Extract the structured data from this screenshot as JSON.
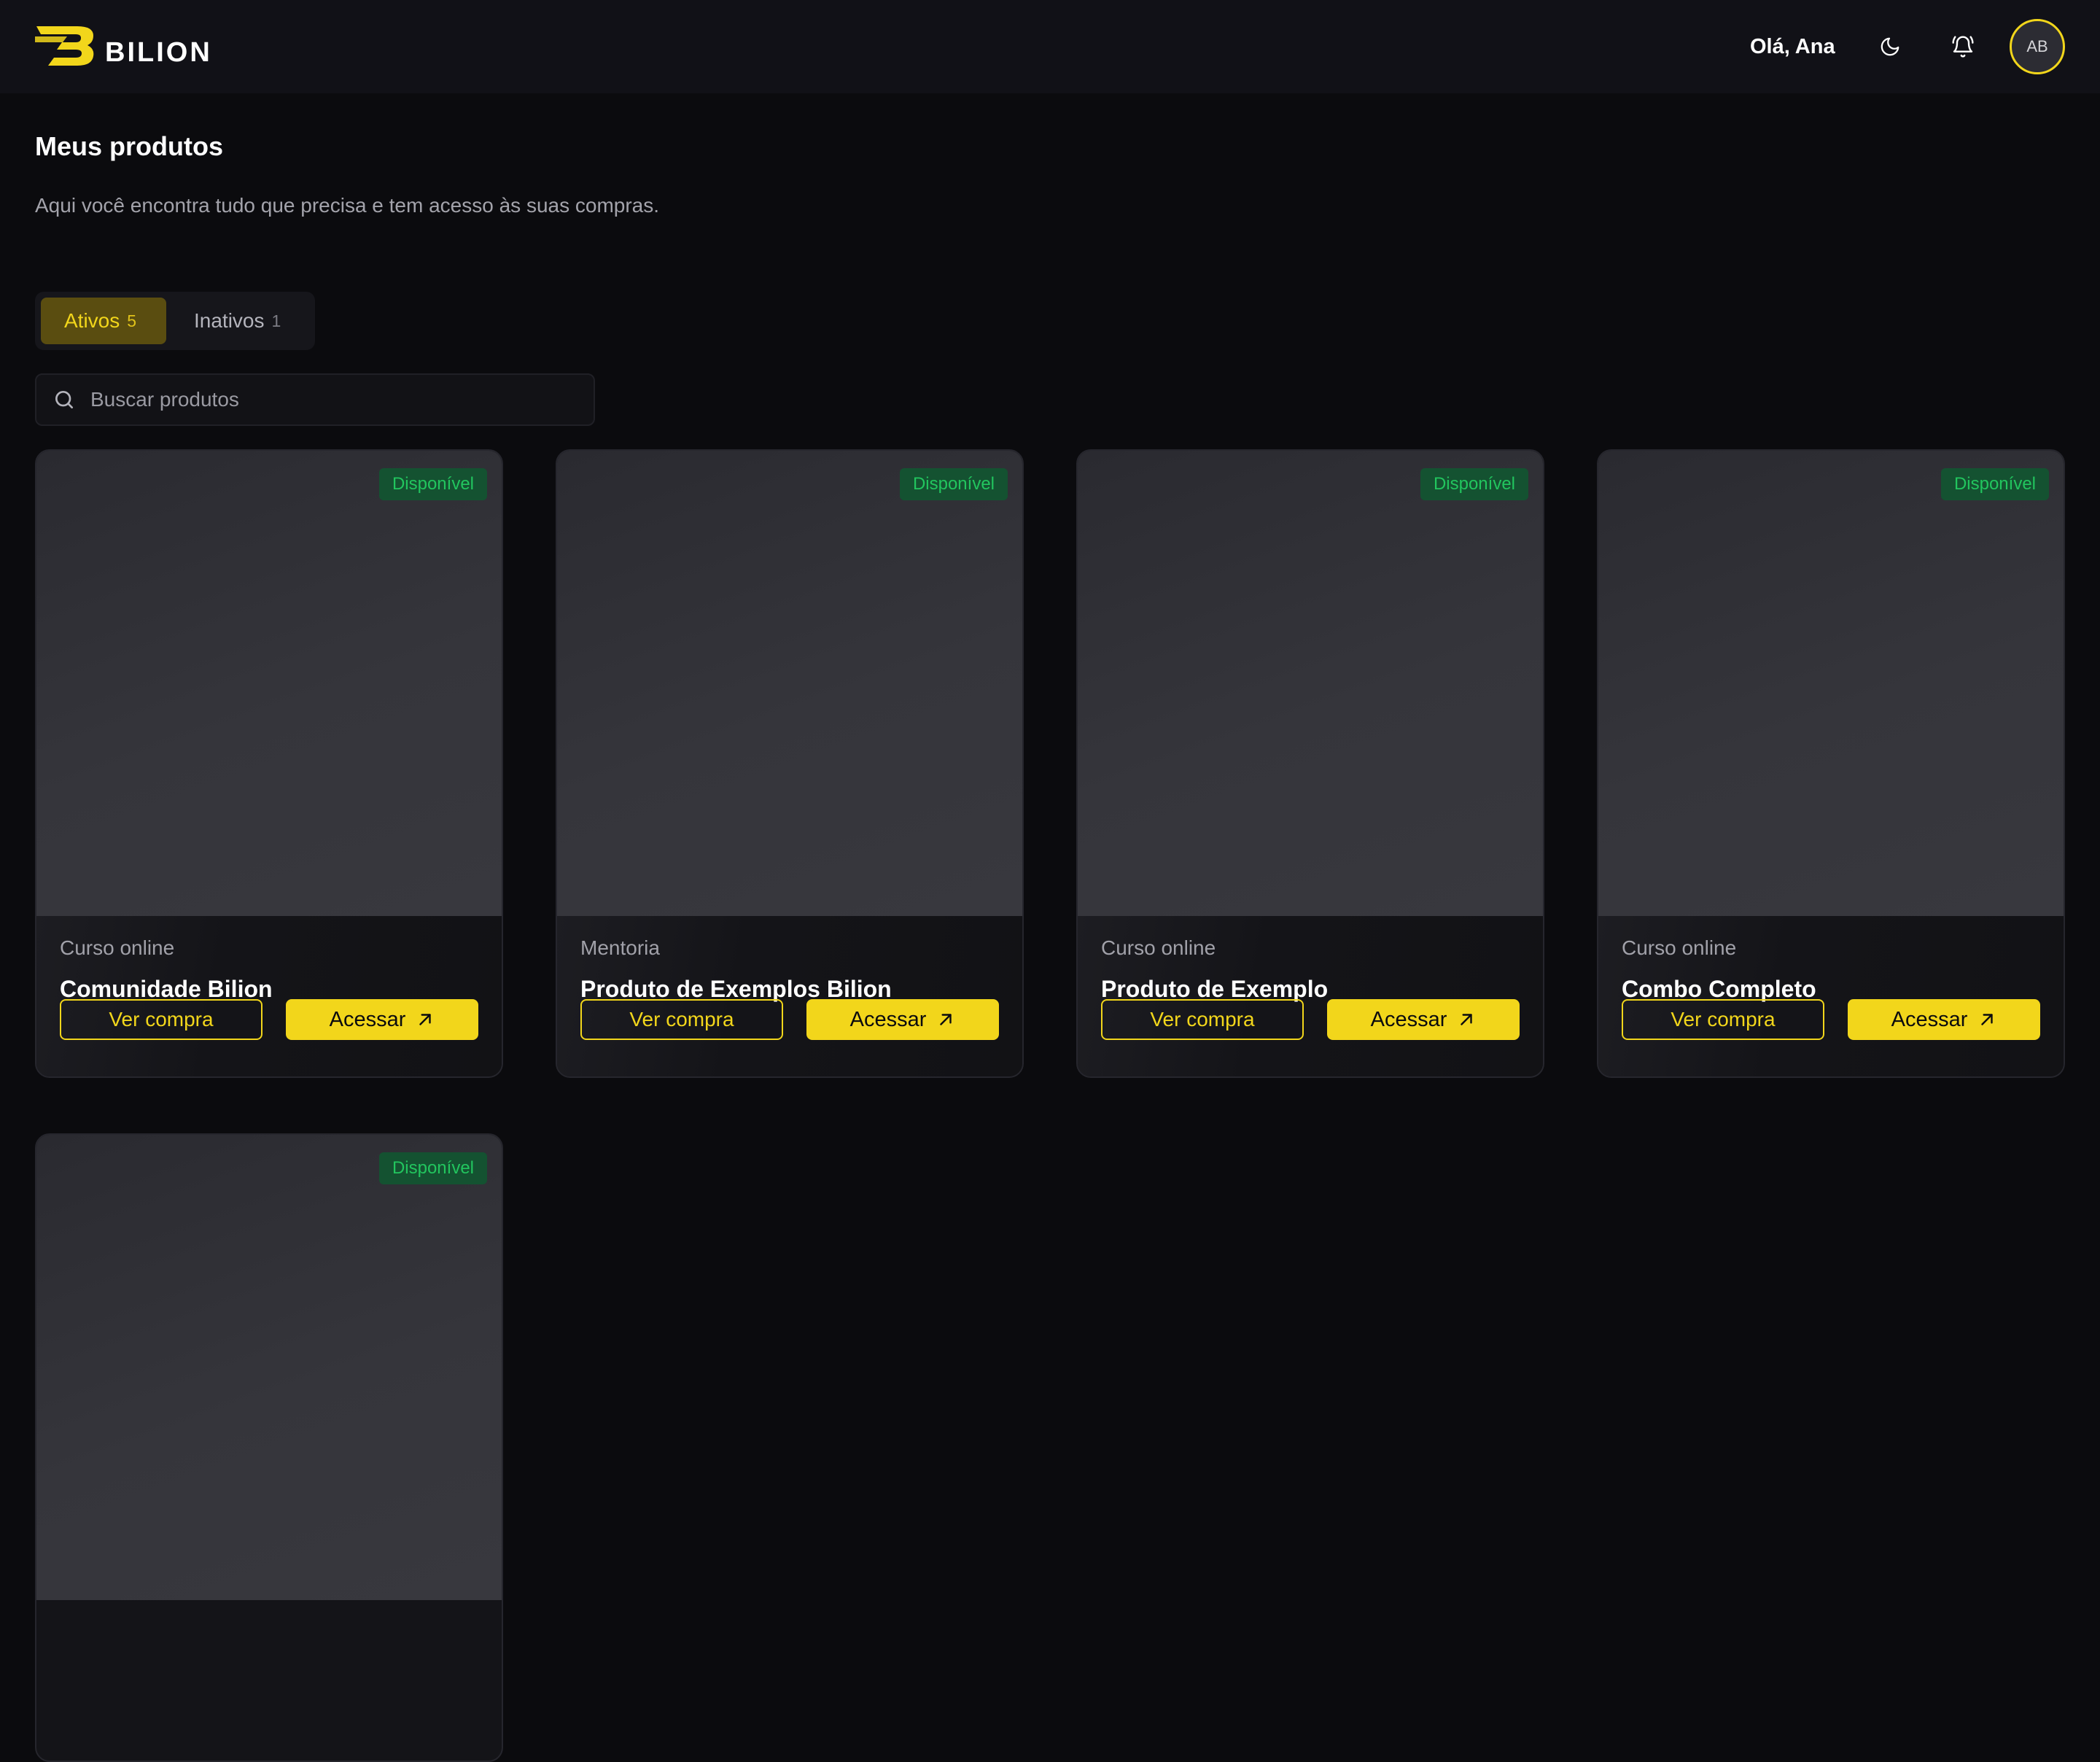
{
  "header": {
    "brand": "BILION",
    "greeting": "Olá, Ana",
    "avatar_initials": "AB",
    "accent_color": "#f2d61b"
  },
  "page": {
    "title": "Meus produtos",
    "subtitle": "Aqui você encontra tudo que precisa e tem acesso às suas compras."
  },
  "tabs": [
    {
      "label": "Ativos",
      "count": "5",
      "active": true
    },
    {
      "label": "Inativos",
      "count": "1",
      "active": false
    }
  ],
  "search": {
    "placeholder": "Buscar produtos",
    "value": ""
  },
  "products": [
    {
      "status": "Disponível",
      "type": "Curso online",
      "name": "Comunidade Bilion",
      "secondary_action": "Ver compra",
      "primary_action": "Acessar"
    },
    {
      "status": "Disponível",
      "type": "Mentoria",
      "name": "Produto de Exemplos Bilion",
      "secondary_action": "Ver compra",
      "primary_action": "Acessar"
    },
    {
      "status": "Disponível",
      "type": "Curso online",
      "name": "Produto de Exemplo",
      "secondary_action": "Ver compra",
      "primary_action": "Acessar"
    },
    {
      "status": "Disponível",
      "type": "Curso online",
      "name": "Combo Completo",
      "secondary_action": "Ver compra",
      "primary_action": "Acessar"
    },
    {
      "status": "Disponível"
    }
  ],
  "icons": {
    "logo": "bilion-logo-icon",
    "theme": "moon-icon",
    "notifications": "bell-icon",
    "search": "search-icon",
    "access": "arrow-up-right-icon"
  },
  "colors": {
    "background": "#0b0b0e",
    "header": "#111117",
    "badge_bg": "#145231",
    "badge_text": "#22c55e"
  }
}
